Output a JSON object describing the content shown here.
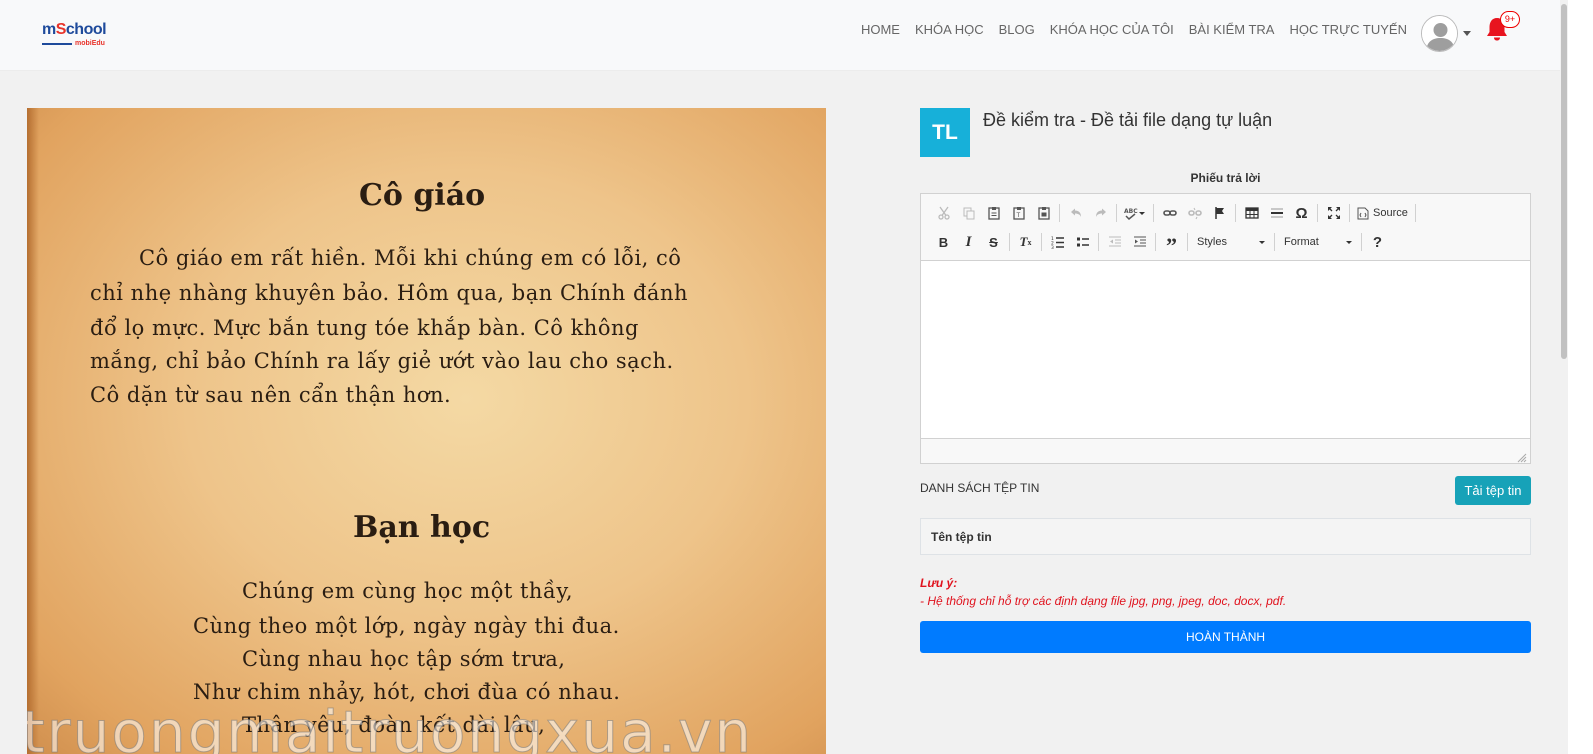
{
  "header": {
    "logo": {
      "main_prefix": "m",
      "main_s": "S",
      "main_rest": "chool",
      "sub": "mobiEdu"
    },
    "nav": [
      {
        "label": "HOME",
        "name": "nav-home"
      },
      {
        "label": "KHÓA HỌC",
        "name": "nav-courses"
      },
      {
        "label": "BLOG",
        "name": "nav-blog"
      },
      {
        "label": "KHÓA HỌC CỦA TÔI",
        "name": "nav-my-courses"
      },
      {
        "label": "BÀI KIỂM TRA",
        "name": "nav-tests"
      },
      {
        "label": "HỌC TRỰC TUYẾN",
        "name": "nav-online-learning"
      }
    ],
    "notification_count": "9+",
    "bell_color": "#e8141f"
  },
  "scan_image": {
    "heading1": "Cô giáo",
    "para1": [
      "Cô giáo em rất hiền. Mỗi khi chúng em có lỗi, cô",
      "chỉ nhẹ nhàng khuyên bảo. Hôm qua, bạn Chính đánh",
      "đổ lọ mực. Mực bắn tung tóe khắp bàn. Cô không",
      "mắng, chỉ bảo Chính ra lấy giẻ ướt vào lau  cho sạch.",
      "Cô dặn từ sau nên cẩn thận hơn."
    ],
    "heading2": "Bạn học",
    "poem": [
      "Chúng em cùng học một thầy,",
      "Cùng theo một lớp, ngày ngày thi đua.",
      "Cùng nhau học tập sớm trưa,",
      "Như chim nhảy, hót, chơi đùa có nhau.",
      "Thân yêu, đoàn kết dài lâu,"
    ],
    "watermark": "truongmaitruongxua.vn"
  },
  "test": {
    "badge": "TL",
    "badge_color": "#17b0d9",
    "title": "Đề kiểm tra - Đề tải file dạng tự luận",
    "answer_sheet_label": "Phiếu trả lời"
  },
  "editor": {
    "source_label": "Source",
    "styles_label": "Styles",
    "format_label": "Format",
    "help_label": "?"
  },
  "files": {
    "list_label": "DANH SÁCH TỆP TIN",
    "upload_label": "Tải tệp tin",
    "column_header": "Tên tệp tin"
  },
  "note": {
    "title": "Lưu ý:",
    "text": "- Hệ thống chỉ hỗ trợ các định dạng file jpg, png, jpeg, doc, docx, pdf."
  },
  "finish_label": "HOÀN THÀNH",
  "colors": {
    "primary": "#007bff",
    "info": "#17a2b8",
    "danger": "#e0131e"
  }
}
